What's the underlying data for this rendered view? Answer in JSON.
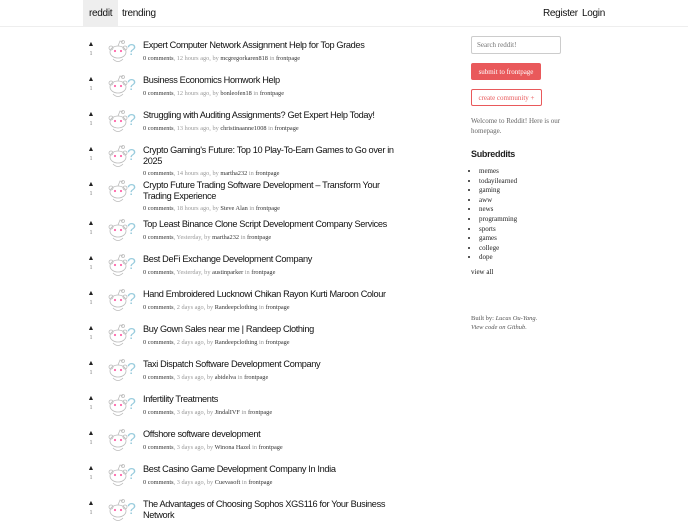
{
  "nav": {
    "brand": "reddit",
    "trending": "trending",
    "register": "Register",
    "login": "Login"
  },
  "posts": [
    {
      "title": "Expert Computer Network Assignment Help for Top Grades",
      "comments": "0 comments",
      "time": "12 hours ago",
      "author": "mcgregorkaren818",
      "sub": "frontpage",
      "score": "1"
    },
    {
      "title": "Business Economics Homwork Help",
      "comments": "0 comments",
      "time": "12 hours ago",
      "author": "bonleofen18",
      "sub": "frontpage",
      "score": "1"
    },
    {
      "title": "Struggling with Auditing Assignments? Get Expert Help Today!",
      "comments": "0 comments",
      "time": "13 hours ago",
      "author": "christinaanne1008",
      "sub": "frontpage",
      "score": "1"
    },
    {
      "title": "Crypto Gaming's Future: Top 10 Play-To-Earn Games to Go over in 2025",
      "comments": "0 comments",
      "time": "14 hours ago",
      "author": "martha232",
      "sub": "frontpage",
      "score": "1"
    },
    {
      "title": "Crypto Future Trading Software Development – Transform Your Trading Experience",
      "comments": "0 comments",
      "time": "18 hours ago",
      "author": "Steve Alan",
      "sub": "frontpage",
      "score": "1"
    },
    {
      "title": "Top Least Binance Clone Script Development Company Services",
      "comments": "0 comments",
      "time": "Yesterday",
      "author": "martha232",
      "sub": "frontpage",
      "score": "1"
    },
    {
      "title": "Best DeFi Exchange Development Company",
      "comments": "0 comments",
      "time": "Yesterday",
      "author": "austinparker",
      "sub": "frontpage",
      "score": "1"
    },
    {
      "title": "Hand Embroidered Lucknowi Chikan Rayon Kurti Maroon Colour",
      "comments": "0 comments",
      "time": "2 days ago",
      "author": "Randeepclothing",
      "sub": "frontpage",
      "score": "1"
    },
    {
      "title": "Buy Gown Sales near me | Randeep Clothing",
      "comments": "0 comments",
      "time": "2 days ago",
      "author": "Randeepclothing",
      "sub": "frontpage",
      "score": "1"
    },
    {
      "title": "Taxi Dispatch Software Development Company",
      "comments": "0 comments",
      "time": "3 days ago",
      "author": "abidelva",
      "sub": "frontpage",
      "score": "1"
    },
    {
      "title": "Infertility Treatments",
      "comments": "0 comments",
      "time": "3 days ago",
      "author": "JindalIVF",
      "sub": "frontpage",
      "score": "1"
    },
    {
      "title": "Offshore software development",
      "comments": "0 comments",
      "time": "3 days ago",
      "author": "Winona Hazel",
      "sub": "frontpage",
      "score": "1"
    },
    {
      "title": "Best Casino Game Development Company In India",
      "comments": "0 comments",
      "time": "3 days ago",
      "author": "Cuevasoft",
      "sub": "frontpage",
      "score": "1"
    },
    {
      "title": "The Advantages of Choosing Sophos XGS116 for Your Business Network",
      "score": "1"
    }
  ],
  "sidebar": {
    "search_placeholder": "Search reddit!",
    "submit": "submit to frontpage",
    "create": "create community +",
    "welcome": "Welcome to Reddit! Here is our homepage.",
    "subreddits_title": "Subreddits",
    "subreddits": [
      "memes",
      "todayilearned",
      "gaming",
      "aww",
      "news",
      "programming",
      "sports",
      "games",
      "college",
      "dope"
    ],
    "view_all": "view all",
    "built_by": "Built by:",
    "author": "Lucas Ou-Yang",
    "view_code": "View code on Github"
  },
  "labels": {
    "sep": ", ",
    "by": ", by ",
    "in": " in "
  }
}
